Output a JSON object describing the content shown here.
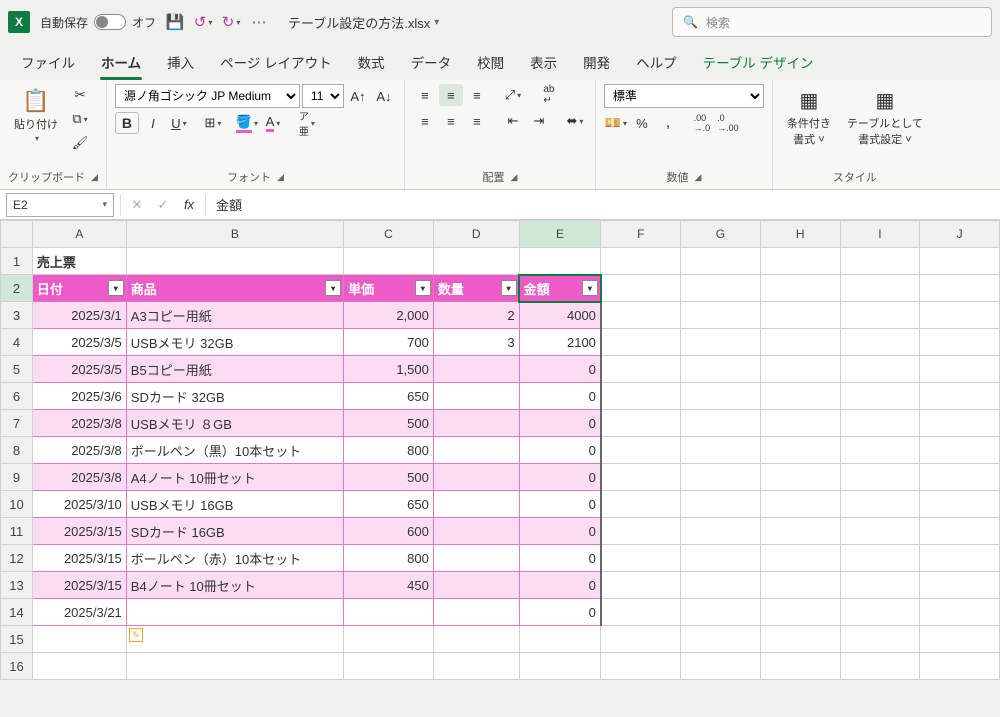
{
  "titlebar": {
    "autosave_label": "自動保存",
    "autosave_state": "オフ",
    "doc_title": "テーブル設定の方法.xlsx",
    "search_placeholder": "検索"
  },
  "tabs": {
    "file": "ファイル",
    "home": "ホーム",
    "insert": "挿入",
    "page_layout": "ページ レイアウト",
    "formulas": "数式",
    "data": "データ",
    "review": "校閲",
    "view": "表示",
    "developer": "開発",
    "help": "ヘルプ",
    "table_design": "テーブル デザイン"
  },
  "ribbon": {
    "clipboard": {
      "paste": "貼り付け",
      "label": "クリップボード"
    },
    "font": {
      "name": "源ノ角ゴシック JP Medium",
      "size": "11",
      "label": "フォント"
    },
    "align": {
      "label": "配置"
    },
    "number": {
      "format": "標準",
      "label": "数値"
    },
    "styles": {
      "cond": "条件付き\n書式 ˅",
      "table": "テーブルとして\n書式設定 ˅",
      "label": "スタイル"
    }
  },
  "formula_bar": {
    "name_box": "E2",
    "formula": "金額"
  },
  "columns": [
    "A",
    "B",
    "C",
    "D",
    "E",
    "F",
    "G",
    "H",
    "I",
    "J"
  ],
  "sheet": {
    "title": "売上票",
    "headers": {
      "date": "日付",
      "product": "商品",
      "price": "単価",
      "qty": "数量",
      "amount": "金額"
    },
    "rows": [
      {
        "date": "2025/3/1",
        "product": "A3コピー用紙",
        "price": "2,000",
        "qty": "2",
        "amount": "4000"
      },
      {
        "date": "2025/3/5",
        "product": "USBメモリ 32GB",
        "price": "700",
        "qty": "3",
        "amount": "2100"
      },
      {
        "date": "2025/3/5",
        "product": "B5コピー用紙",
        "price": "1,500",
        "qty": "",
        "amount": "0"
      },
      {
        "date": "2025/3/6",
        "product": "SDカード 32GB",
        "price": "650",
        "qty": "",
        "amount": "0"
      },
      {
        "date": "2025/3/8",
        "product": "USBメモリ ８GB",
        "price": "500",
        "qty": "",
        "amount": "0"
      },
      {
        "date": "2025/3/8",
        "product": "ボールペン（黒）10本セット",
        "price": "800",
        "qty": "",
        "amount": "0"
      },
      {
        "date": "2025/3/8",
        "product": "A4ノート 10冊セット",
        "price": "500",
        "qty": "",
        "amount": "0"
      },
      {
        "date": "2025/3/10",
        "product": "USBメモリ 16GB",
        "price": "650",
        "qty": "",
        "amount": "0"
      },
      {
        "date": "2025/3/15",
        "product": "SDカード 16GB",
        "price": "600",
        "qty": "",
        "amount": "0"
      },
      {
        "date": "2025/3/15",
        "product": "ボールペン（赤）10本セット",
        "price": "800",
        "qty": "",
        "amount": "0"
      },
      {
        "date": "2025/3/15",
        "product": "B4ノート 10冊セット",
        "price": "450",
        "qty": "",
        "amount": "0"
      },
      {
        "date": "2025/3/21",
        "product": "",
        "price": "",
        "qty": "",
        "amount": "0"
      }
    ]
  }
}
